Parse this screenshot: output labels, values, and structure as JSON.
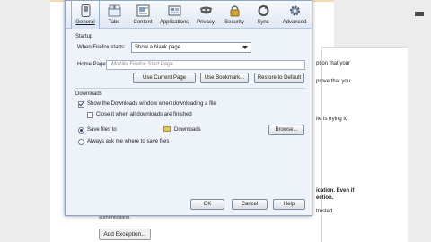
{
  "background": {
    "right_texts": [
      "ption that your",
      "prove that you",
      "ite is trying to",
      "ication. Even if",
      "ection.",
      "trusted"
    ],
    "left_text": "authentication.",
    "add_exception_label": "Add Exception..."
  },
  "dialog": {
    "tabs": [
      {
        "name": "general",
        "label": "General",
        "selected": true
      },
      {
        "name": "tabs",
        "label": "Tabs",
        "selected": false
      },
      {
        "name": "content",
        "label": "Content",
        "selected": false
      },
      {
        "name": "applications",
        "label": "Applications",
        "selected": false
      },
      {
        "name": "privacy",
        "label": "Privacy",
        "selected": false
      },
      {
        "name": "security",
        "label": "Security",
        "selected": false
      },
      {
        "name": "sync",
        "label": "Sync",
        "selected": false
      },
      {
        "name": "advanced",
        "label": "Advanced",
        "selected": false
      }
    ],
    "startup": {
      "group_title": "Startup",
      "when_starts_label": "When Firefox starts:",
      "when_starts_value": "Show a blank page",
      "home_page_label": "Home Page:",
      "home_page_placeholder": "Mozilla Firefox Start Page",
      "use_current_page": "Use Current Page",
      "use_bookmark": "Use Bookmark...",
      "restore_default": "Restore to Default"
    },
    "downloads": {
      "group_title": "Downloads",
      "show_window_label": "Show the Downloads window when downloading a file",
      "show_window_checked": true,
      "close_when_finished_label": "Close it when all downloads are finished",
      "close_when_finished_checked": false,
      "save_files_label": "Save files to",
      "save_folder": "Downloads",
      "browse": "Browse...",
      "always_ask_label": "Always ask me where to save files",
      "save_choice": "save-files-to"
    },
    "buttons": {
      "ok": "OK",
      "cancel": "Cancel",
      "help": "Help"
    }
  }
}
